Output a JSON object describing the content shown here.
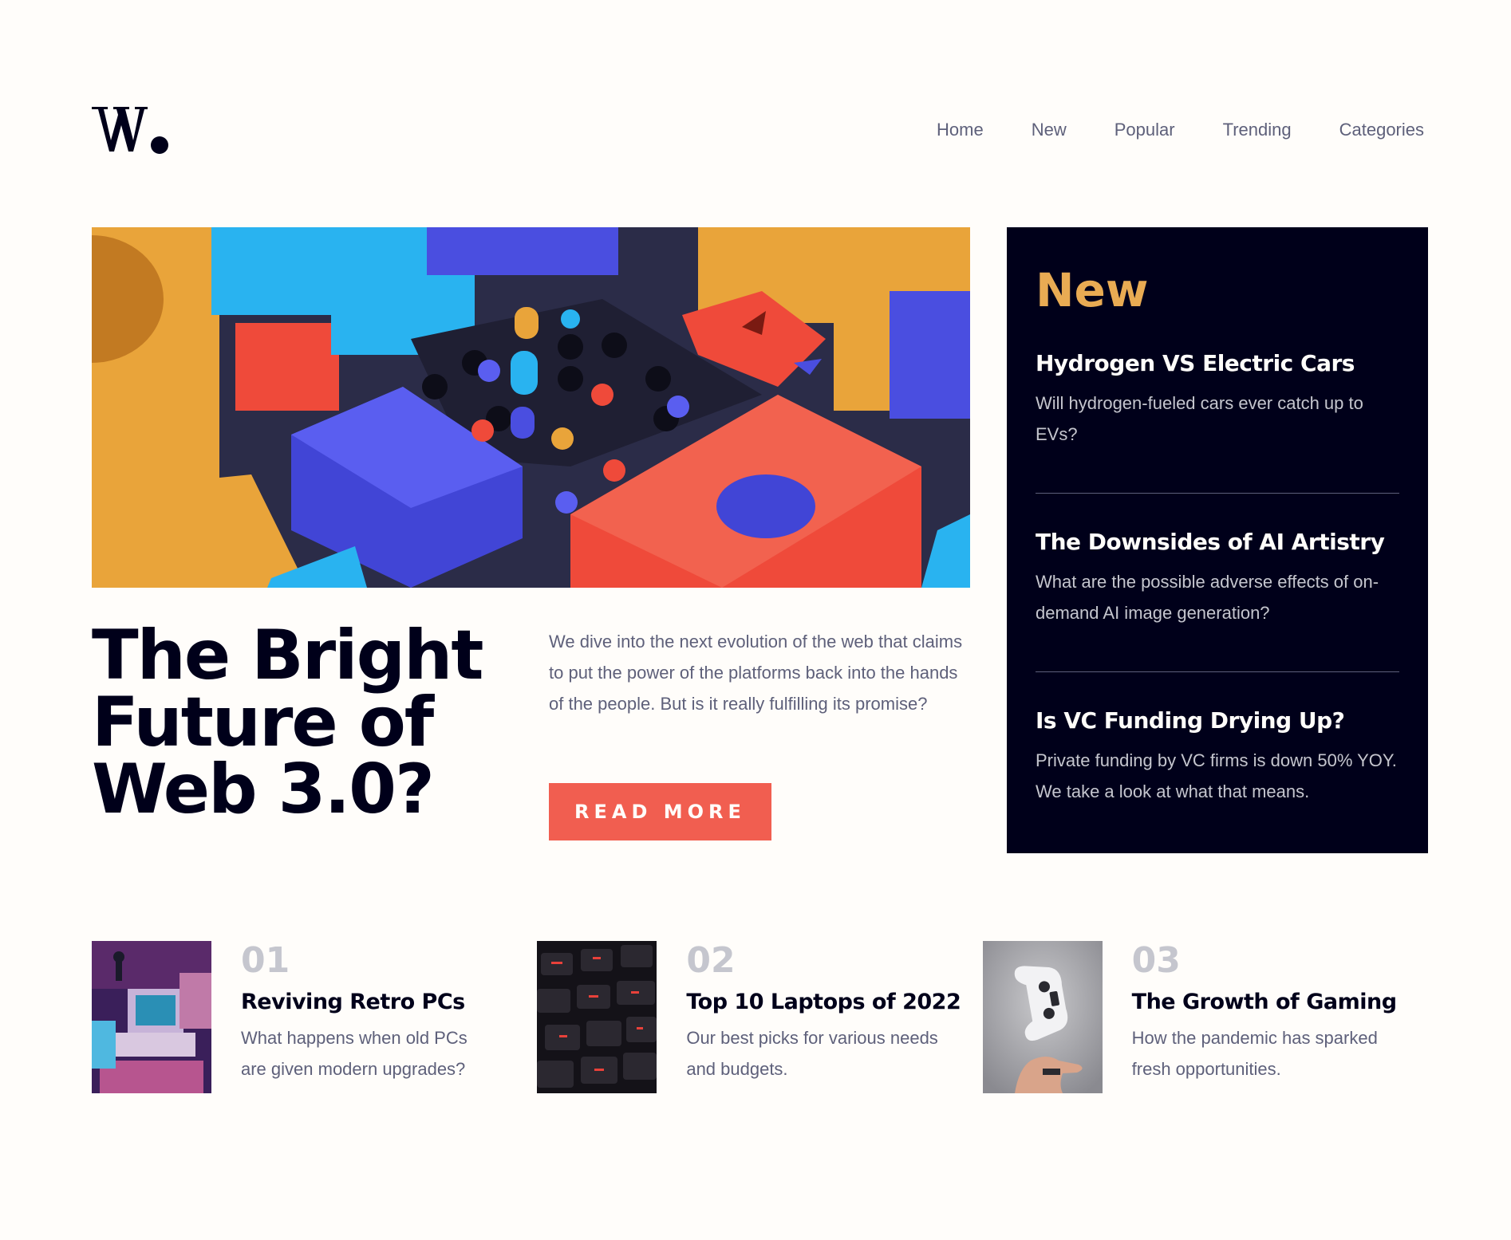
{
  "header": {
    "logo_text": "W.",
    "nav": [
      "Home",
      "New",
      "Popular",
      "Trending",
      "Categories"
    ]
  },
  "hero": {
    "title": "The Bright Future of Web 3.0?",
    "description": "We dive into the next evolution of the web that claims to put the power of the platforms back into the hands of the people. But is it really fulfilling its promise?",
    "cta_label": "READ MORE"
  },
  "new_panel": {
    "heading": "New",
    "items": [
      {
        "title": "Hydrogen VS Electric Cars",
        "desc": "Will hydrogen-fueled cars ever catch up to EVs?"
      },
      {
        "title": "The Downsides of AI Artistry",
        "desc": "What are the possible adverse effects of on-demand AI image generation?"
      },
      {
        "title": "Is VC Funding Drying Up?",
        "desc": "Private funding by VC firms is down 50% YOY. We take a look at what that means."
      }
    ]
  },
  "cards": [
    {
      "num": "01",
      "title": "Reviving Retro PCs",
      "desc": "What happens when old PCs are given modern upgrades?"
    },
    {
      "num": "02",
      "title": "Top 10 Laptops of 2022",
      "desc": "Our best picks for various needs and budgets."
    },
    {
      "num": "03",
      "title": "The Growth of Gaming",
      "desc": "How the pandemic has sparked fresh opportunities."
    }
  ],
  "colors": {
    "background": "#fffdfa",
    "dark": "#00001a",
    "accent_red": "#f15e50",
    "accent_orange": "#e9ab53",
    "grayish_blue": "#5e607a",
    "light_gray": "#c5c6ce"
  }
}
